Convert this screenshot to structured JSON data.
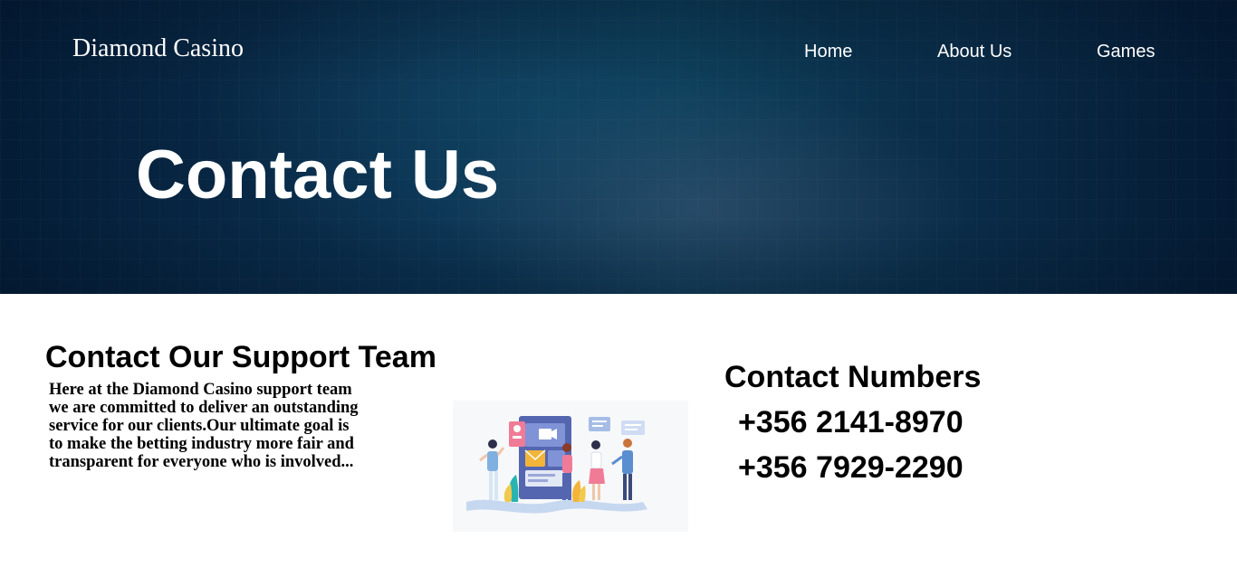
{
  "header": {
    "brand": "Diamond Casino",
    "nav": [
      {
        "label": "Home"
      },
      {
        "label": "About Us"
      },
      {
        "label": "Games"
      }
    ]
  },
  "hero": {
    "title": "Contact Us"
  },
  "support": {
    "title": "Contact Our Support Team",
    "text": "Here at the Diamond Casino support team we are committed to deliver an outstanding service for our clients.Our ultimate goal is to make the betting industry more fair and transparent for everyone who is involved..."
  },
  "contact_numbers": {
    "title": "Contact Numbers",
    "numbers": [
      "+356 2141-8970",
      "+356 7929-2290"
    ]
  },
  "colors": {
    "hero_dark": "#041c36",
    "hero_mid": "#0c3a55",
    "text": "#000000",
    "hero_text": "#ffffff"
  },
  "icons": {
    "illustration": "support-team-illustration"
  }
}
